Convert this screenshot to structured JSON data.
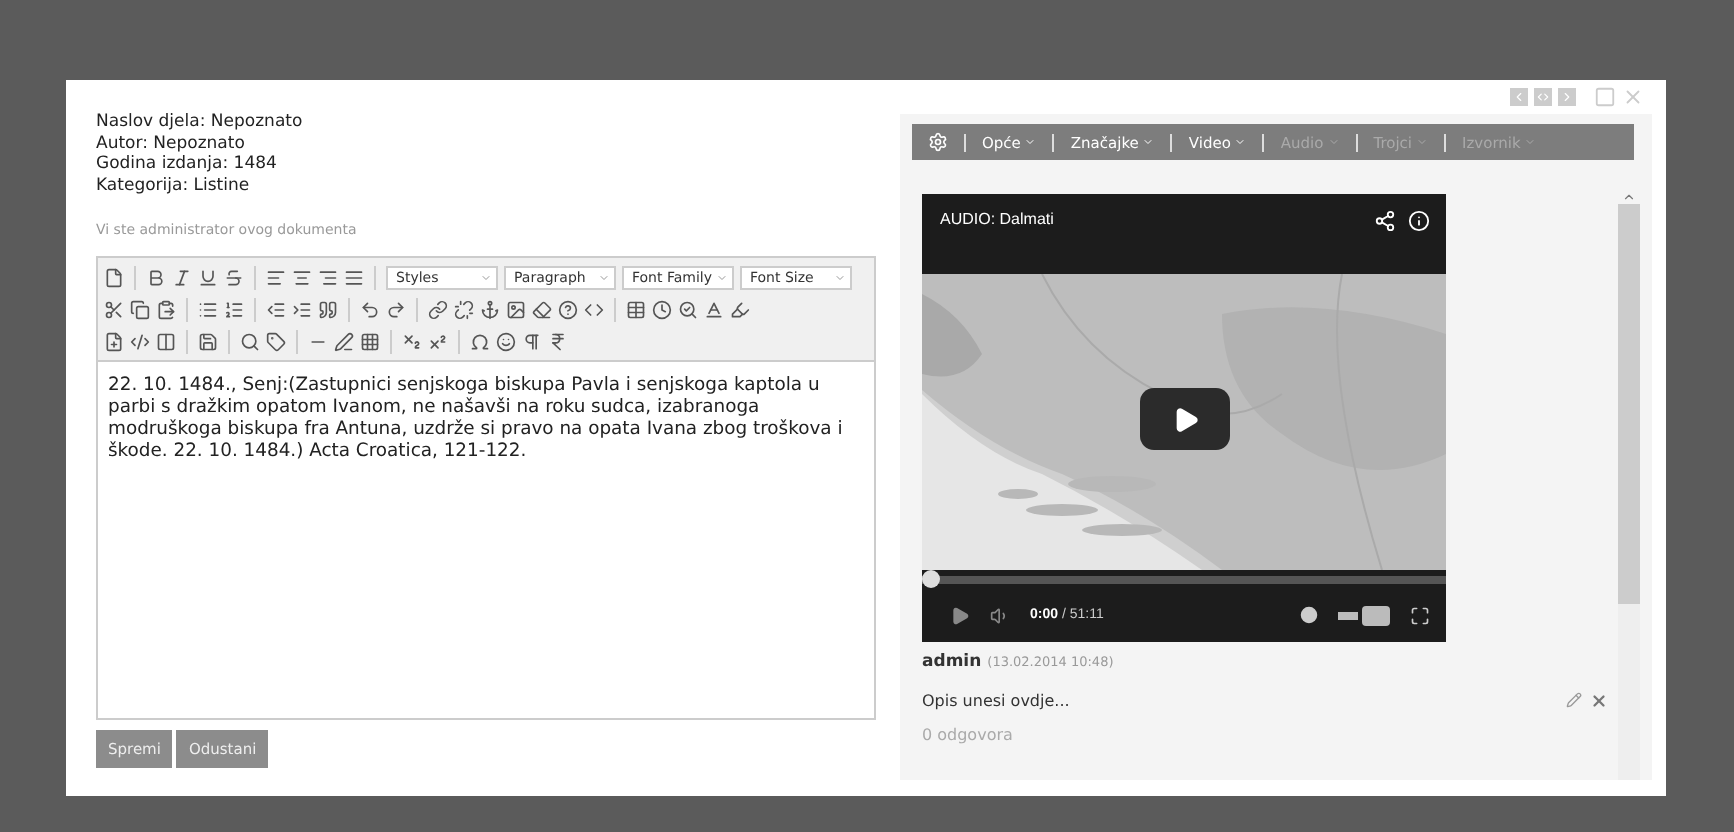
{
  "document_info": [
    "Naslov djela: Nepoznato",
    "Autor: Nepoznato",
    "Godina izdanja: 1484",
    "Kategorija: Listine"
  ],
  "admin_note": "Vi ste administrator ovog dokumenta",
  "editor": {
    "dropdowns": [
      {
        "label": "Styles"
      },
      {
        "label": "Paragraph"
      },
      {
        "label": "Font Family"
      },
      {
        "label": "Font Size"
      }
    ],
    "content": "22. 10. 1484., Senj:(Zastupnici senjskoga biskupa Pavla i senjskoga kaptola u parbi s dražkim opatom Ivanom, ne našavši na roku sudca, izabranoga modruškoga biskupa fra Antuna, uzdrže si pravo na opata Ivana zbog troškova i škode. 22. 10. 1484.) Acta Croatica, 121-122."
  },
  "buttons": [
    "Spremi",
    "Odustani"
  ],
  "menu": [
    {
      "label": "Opće",
      "disabled": false
    },
    {
      "label": "Značajke",
      "disabled": false
    },
    {
      "label": "Video",
      "disabled": false
    },
    {
      "label": "Audio",
      "disabled": true
    },
    {
      "label": "Trojci",
      "disabled": true
    },
    {
      "label": "Izvornik",
      "disabled": true
    }
  ],
  "video": {
    "title": "AUDIO: Dalmati",
    "time": "0:00",
    "duration": "/ 51:11",
    "level": 0
  },
  "comment": {
    "author": "admin",
    "date": "(13.02.2014 10:48)",
    "text": "Opis unesi ovdje...",
    "replies": "0 odgovora"
  }
}
